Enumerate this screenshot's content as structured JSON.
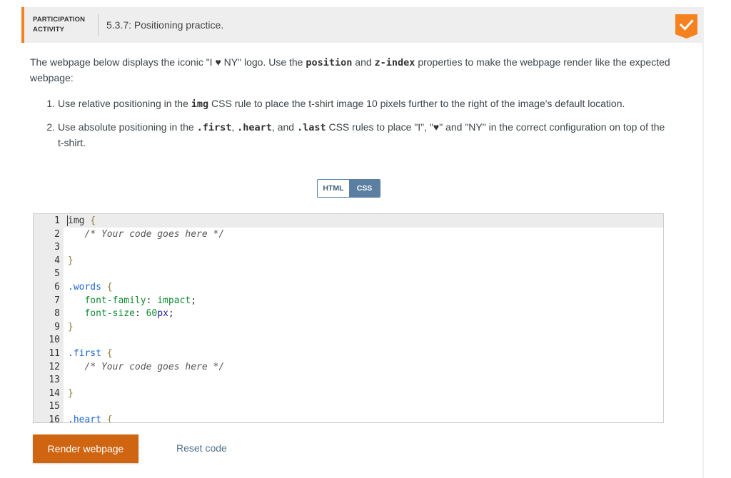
{
  "activity": {
    "label_line1": "PARTICIPATION",
    "label_line2": "ACTIVITY",
    "title": "5.3.7: Positioning practice.",
    "completion_icon": "check-badge-icon",
    "accent_color": "#f5821f"
  },
  "instructions": {
    "intro_part1": "The webpage below displays the iconic \"I ",
    "intro_heart": "♥",
    "intro_part2": " NY\" logo. Use the ",
    "intro_code1": "position",
    "intro_part3": " and ",
    "intro_code2": "z-index",
    "intro_part4": " properties to make the webpage render like the expected webpage:",
    "steps": [
      {
        "part1": "Use relative positioning in the ",
        "code1": "img",
        "part2": " CSS rule to place the t-shirt image 10 pixels further to the right of the image's default location."
      },
      {
        "part1": "Use absolute positioning in the ",
        "code1": ".first",
        "sep1": ", ",
        "code2": ".heart",
        "sep2": ", and ",
        "code3": ".last",
        "part2": " CSS rules to place \"I\", \"",
        "heart": "♥",
        "part3": "\" and \"NY\" in the correct configuration on top of the t-shirt."
      }
    ]
  },
  "tabs": {
    "html": "HTML",
    "css": "CSS",
    "active": "CSS"
  },
  "editor": {
    "lines": [
      {
        "n": "1",
        "sel": "img",
        "brace": " {"
      },
      {
        "n": "2",
        "indent": "   ",
        "comment": "/* Your code goes here */"
      },
      {
        "n": "3"
      },
      {
        "n": "4",
        "brace": "}"
      },
      {
        "n": "5"
      },
      {
        "n": "6",
        "cls": ".words",
        "brace": " {"
      },
      {
        "n": "7",
        "indent": "   ",
        "prop": "font-family",
        "colon": ": ",
        "val": "impact",
        "semi": ";"
      },
      {
        "n": "8",
        "indent": "   ",
        "prop": "font-size",
        "colon": ": ",
        "num": "60",
        "unit": "px",
        "semi": ";"
      },
      {
        "n": "9",
        "brace": "}"
      },
      {
        "n": "10"
      },
      {
        "n": "11",
        "cls": ".first",
        "brace": " {"
      },
      {
        "n": "12",
        "indent": "   ",
        "comment": "/* Your code goes here */"
      },
      {
        "n": "13"
      },
      {
        "n": "14",
        "brace": "}"
      },
      {
        "n": "15"
      },
      {
        "n": "16",
        "cls": ".heart",
        "brace": " {"
      }
    ]
  },
  "actions": {
    "render": "Render webpage",
    "reset": "Reset code"
  }
}
